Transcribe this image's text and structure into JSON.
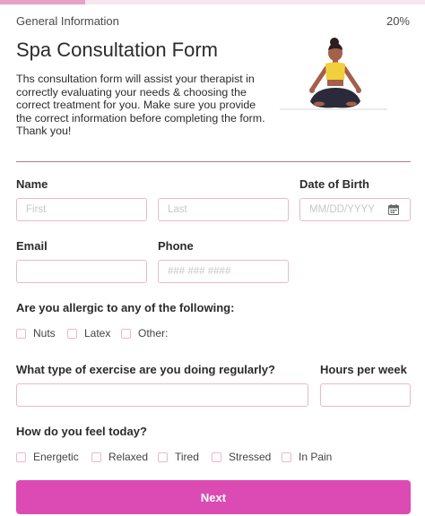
{
  "header": {
    "section": "General Information",
    "progress_text": "20%",
    "progress_fraction": 0.2
  },
  "intro": {
    "title": "Spa Consultation Form",
    "text": "Ths consultation form will assist your therapist in correctly evaluating your needs & choosing the correct treatment for you. Make sure you provide the correct information before completing the form. Thank you!"
  },
  "fields": {
    "name_label": "Name",
    "first_placeholder": "First",
    "last_placeholder": "Last",
    "dob_label": "Date of Birth",
    "dob_placeholder": "MM/DD/YYYY",
    "email_label": "Email",
    "email_value": "",
    "phone_label": "Phone",
    "phone_placeholder": "### ### ####",
    "exercise_label": "What type of exercise are you doing regularly?",
    "exercise_value": "",
    "hours_label": "Hours per week",
    "hours_value": ""
  },
  "allergies": {
    "label": "Are you allergic to any of the following:",
    "options": [
      "Nuts",
      "Latex",
      "Other:"
    ]
  },
  "feelings": {
    "label": "How do you feel today?",
    "options": [
      "Energetic",
      "Relaxed",
      "Tired",
      "Stressed",
      "In Pain"
    ]
  },
  "actions": {
    "next_label": "Next"
  },
  "colors": {
    "accent": "#dc4bb3",
    "field_border": "#efb6cf",
    "progress": "#e7a3c5"
  },
  "icons": {
    "date": "calendar-icon",
    "illustration": "meditation-illustration"
  }
}
